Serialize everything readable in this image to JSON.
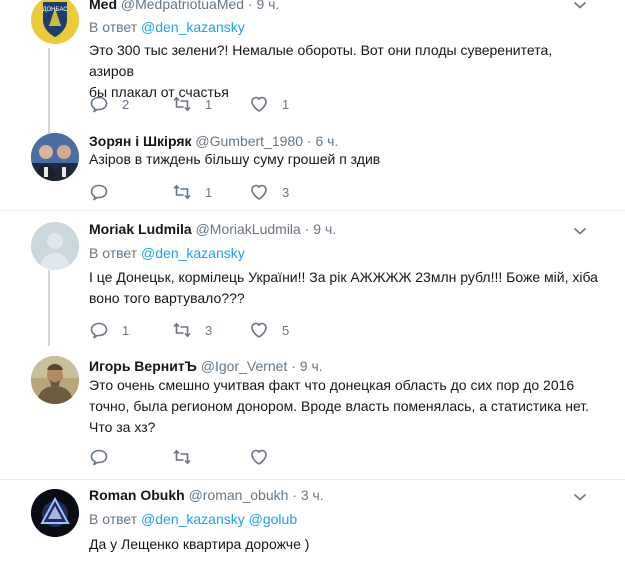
{
  "colors": {
    "link": "#1da1f2",
    "muted": "#657786",
    "divider": "#e6ecf0",
    "text": "#14171a"
  },
  "tweets": [
    {
      "name": "Med",
      "handle": "@MedpatriotuaMed",
      "time": "· 9 ч.",
      "reply_prefix": "В ответ",
      "reply_to": "@den_kazansky",
      "text_lines": [
        "Это 300 тыс зелени?! Немалые обороты. Вот они плоды суверенитета, азиров",
        "бы плакал от счастья"
      ],
      "replies": "2",
      "retweets": "1",
      "likes": "1",
      "avatar_icon": "donbas-emblem-icon"
    },
    {
      "name": "Зорян і Шкіряк",
      "handle": "@Gumbert_1980",
      "time": "· 6 ч.",
      "text_lines": [
        "Азіров в тиждень більшу суму грошей п  здив"
      ],
      "replies": "",
      "retweets": "1",
      "likes": "3",
      "avatar_icon": "two-men-photo-icon"
    },
    {
      "name": "Moriak Ludmila",
      "handle": "@MoriakLudmila",
      "time": "· 9 ч.",
      "reply_prefix": "В ответ",
      "reply_to": "@den_kazansky",
      "text_lines": [
        "І це Донецьк, кормілець України!! За рік АЖЖЖЖ 23млн рубл!!! Боже мій, хіба",
        "воно того вартувало???"
      ],
      "replies": "1",
      "retweets": "3",
      "likes": "5",
      "avatar_icon": "default-profile-icon"
    },
    {
      "name": "Игорь ВернитЪ",
      "handle": "@Igor_Vernet",
      "time": "· 9 ч.",
      "text_lines": [
        "Это очень смешно учитвая факт что донецкая область до сих пор до 2016",
        "точно, была регионом донором. Вроде власть поменялась, а статистика нет.",
        "Что за хз?"
      ],
      "replies": "",
      "retweets": "",
      "likes": "",
      "avatar_icon": "cossack-portrait-icon"
    },
    {
      "name": "Roman Obukh",
      "handle": "@roman_obukh",
      "time": "· 3 ч.",
      "reply_prefix": "В ответ",
      "reply_to": "@den_kazansky @golub",
      "text_lines": [
        "Да у Лещенко квартира дорожче )"
      ],
      "avatar_icon": "triangle-logo-icon"
    }
  ]
}
